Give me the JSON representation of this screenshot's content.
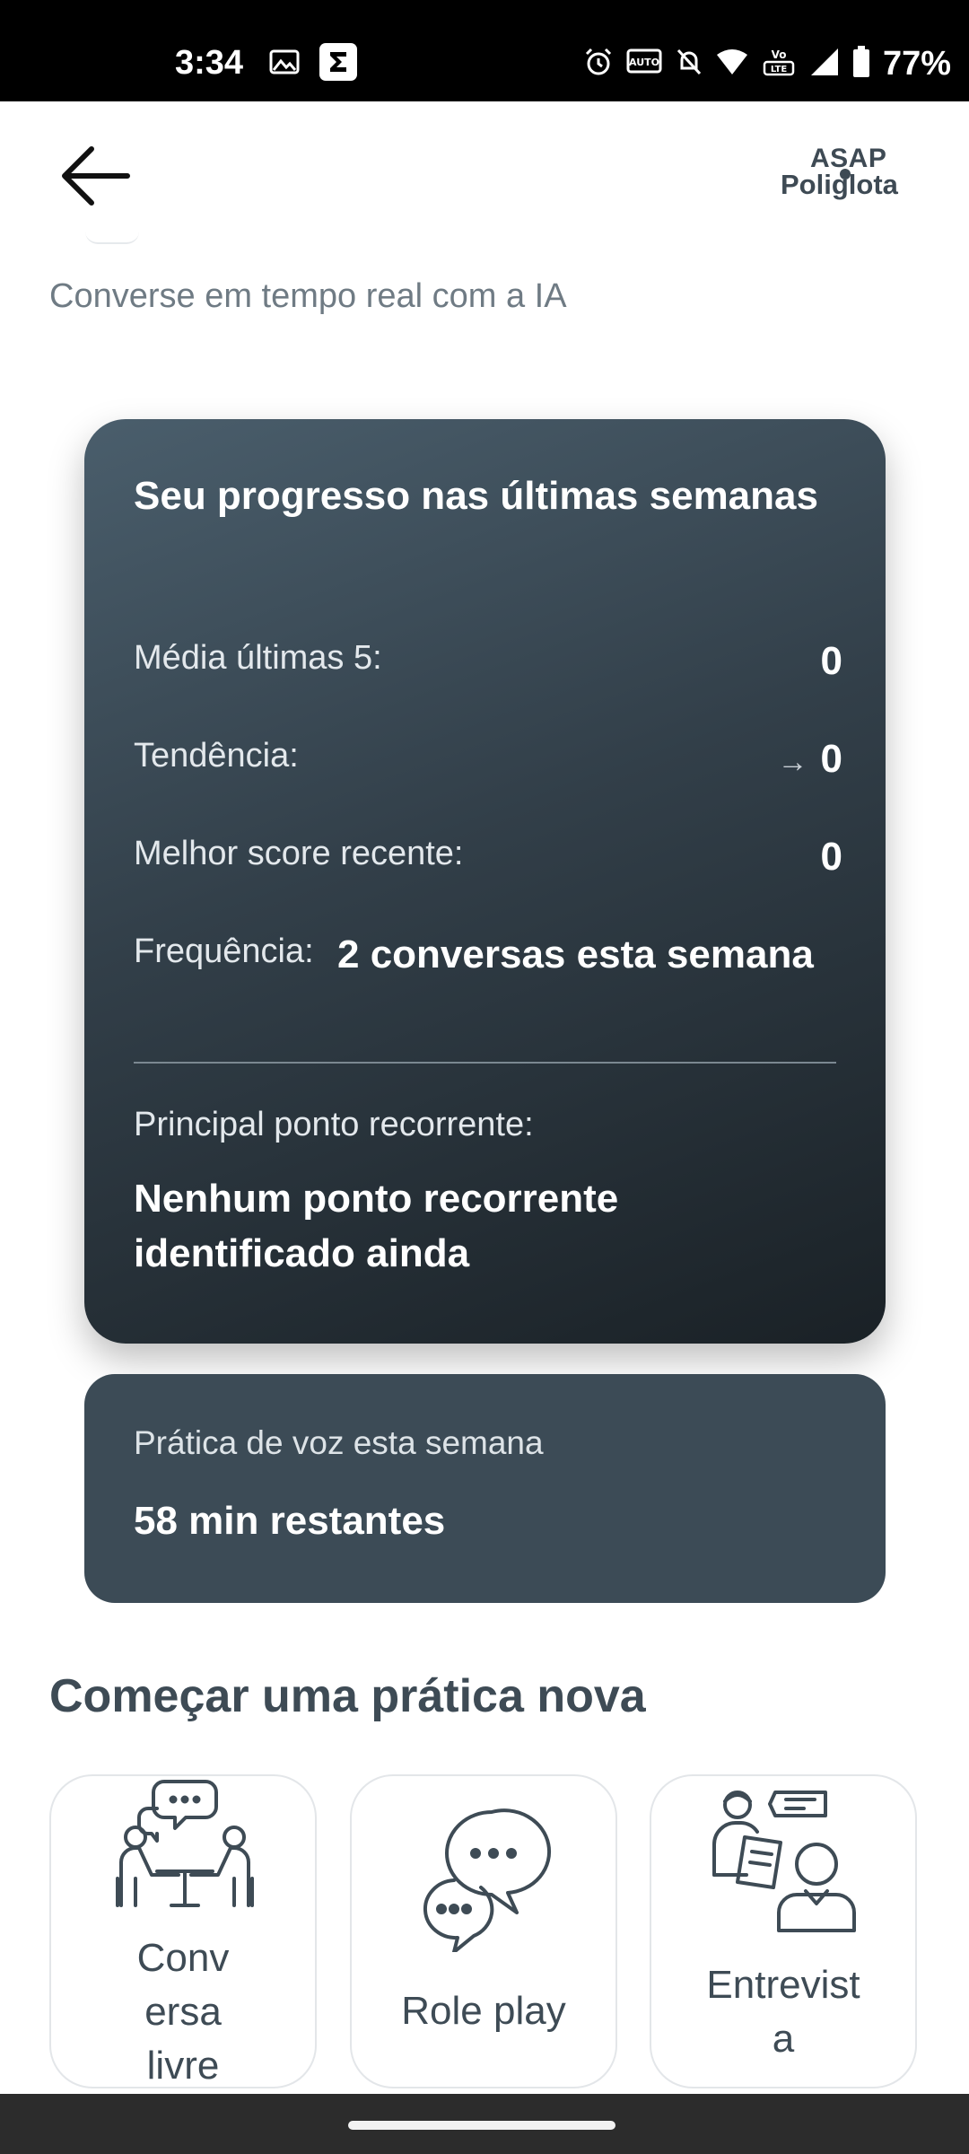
{
  "status_bar": {
    "time": "3:34",
    "battery": "77%",
    "icons": [
      "image-icon",
      "sigma-app-icon",
      "alarm-icon",
      "auto-hz-icon",
      "bell-off-icon",
      "wifi-icon",
      "volte-icon",
      "signal-icon",
      "battery-icon"
    ]
  },
  "app_bar": {
    "back_icon": "arrow-left-icon",
    "logo_line1": "ASAP",
    "logo_line2": "Poliglota"
  },
  "subtitle": "Converse em tempo real com a IA",
  "progress_card": {
    "title": "Seu progresso nas últimas semanas",
    "avg_label": "Média últimas 5:",
    "avg_value": "0",
    "trend_label": "Tendência:",
    "trend_arrow": "→",
    "trend_value": "0",
    "best_label": "Melhor score recente:",
    "best_value": "0",
    "freq_label": "Frequência:",
    "freq_value": "2 conversas esta semana",
    "recurrent_label": "Principal ponto recorrente:",
    "recurrent_value": "Nenhum ponto recorrente identificado ainda"
  },
  "voice_card": {
    "label": "Prática de voz esta semana",
    "value": "58 min restantes"
  },
  "section_title": "Começar uma prática nova",
  "practice_tiles": [
    {
      "label_lines": [
        "Conv",
        "ersa",
        "livre"
      ],
      "icon": "conversation-table-icon"
    },
    {
      "label": "Role play",
      "icon": "chat-bubbles-icon"
    },
    {
      "label_lines": [
        "Entrevist",
        "a"
      ],
      "icon": "interview-icon"
    }
  ],
  "colors": {
    "card_dark": "#323f49",
    "voice_card": "#3c4b56",
    "heading": "#3e4b55",
    "subtitle": "#6f7b84"
  }
}
